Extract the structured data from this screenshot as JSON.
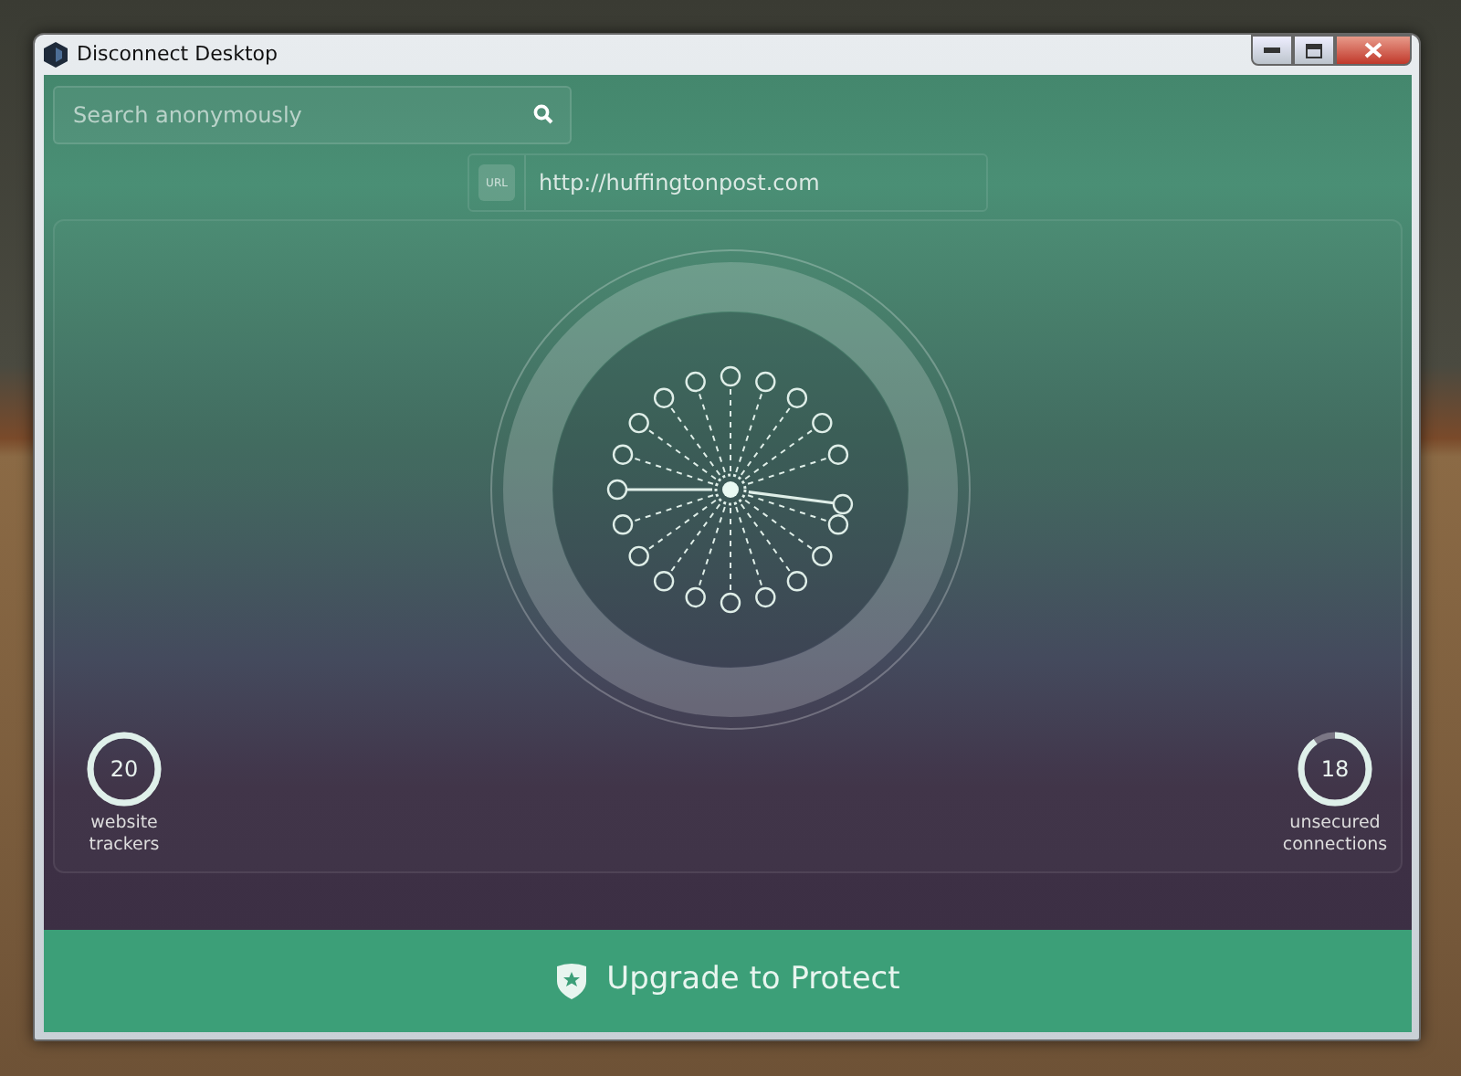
{
  "window": {
    "title": "Disconnect Desktop"
  },
  "search": {
    "placeholder": "Search anonymously"
  },
  "url_bar": {
    "badge": "URL",
    "value": "http://huffingtonpost.com"
  },
  "stats": [
    {
      "value": "20",
      "label": "website trackers",
      "level": 1.0
    },
    {
      "value": "18",
      "label": "unsecured connections",
      "level": 0.9
    }
  ],
  "upgrade_button": {
    "label": "Upgrade to Protect"
  }
}
